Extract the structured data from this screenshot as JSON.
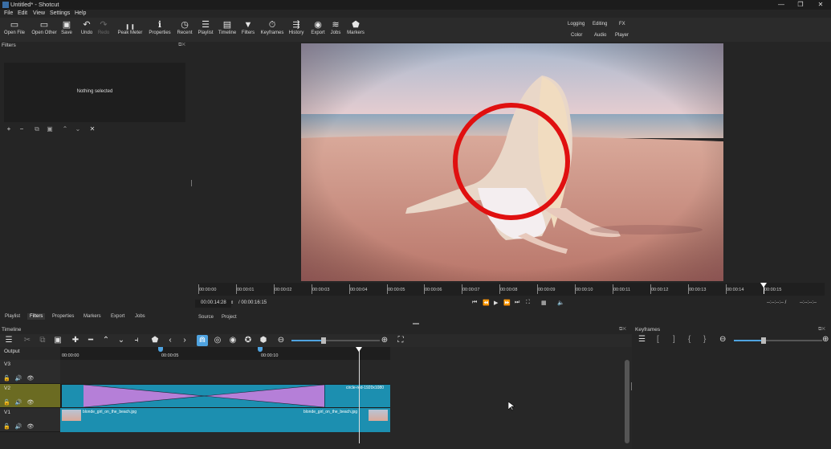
{
  "window": {
    "title": "Untitled* - Shotcut",
    "controls": [
      "—",
      "❐",
      "✕"
    ]
  },
  "menu": [
    "File",
    "Edit",
    "View",
    "Settings",
    "Help"
  ],
  "toolbar": [
    {
      "label": "Open File",
      "icon": "open-file-icon",
      "glyph": "▭",
      "enabled": true
    },
    {
      "label": "Open Other",
      "icon": "open-other-icon",
      "glyph": "▭",
      "enabled": true
    },
    {
      "label": "Save",
      "icon": "save-icon",
      "glyph": "▣",
      "enabled": true
    },
    {
      "label": "Undo",
      "icon": "undo-icon",
      "glyph": "↶",
      "enabled": true
    },
    {
      "label": "Redo",
      "icon": "redo-icon",
      "glyph": "↷",
      "enabled": false
    },
    {
      "label": "Peak Meter",
      "icon": "peak-meter-icon",
      "glyph": "╻╻",
      "enabled": true
    },
    {
      "label": "Properties",
      "icon": "properties-icon",
      "glyph": "ℹ",
      "enabled": true
    },
    {
      "label": "Recent",
      "icon": "recent-icon",
      "glyph": "◷",
      "enabled": true
    },
    {
      "label": "Playlist",
      "icon": "playlist-icon",
      "glyph": "☰",
      "enabled": true
    },
    {
      "label": "Timeline",
      "icon": "timeline-icon",
      "glyph": "▤",
      "enabled": true
    },
    {
      "label": "Filters",
      "icon": "filters-icon",
      "glyph": "▼",
      "enabled": true
    },
    {
      "label": "Keyframes",
      "icon": "keyframes-icon",
      "glyph": "⏱",
      "enabled": true
    },
    {
      "label": "History",
      "icon": "history-icon",
      "glyph": "⇶",
      "enabled": true
    },
    {
      "label": "Export",
      "icon": "export-icon",
      "glyph": "◉",
      "enabled": true
    },
    {
      "label": "Jobs",
      "icon": "jobs-icon",
      "glyph": "≋",
      "enabled": true
    },
    {
      "label": "Markers",
      "icon": "markers-icon",
      "glyph": "⬟",
      "enabled": true
    }
  ],
  "layouts": {
    "row1": [
      "Logging",
      "Editing",
      "FX"
    ],
    "row2": [
      "Color",
      "Audio",
      "Player"
    ]
  },
  "filters_panel": {
    "title": "Filters",
    "empty_text": "Nothing selected"
  },
  "left_tabs": [
    "Playlist",
    "Filters",
    "Properties",
    "Markers",
    "Export",
    "Jobs"
  ],
  "left_tabs_active": 1,
  "viewer": {
    "ruler_ticks": [
      "00:00:00",
      "00:00:01",
      "00:00:02",
      "00:00:03",
      "00:00:04",
      "00:00:05",
      "00:00:06",
      "00:00:07",
      "00:00:08",
      "00:00:09",
      "00:00:10",
      "00:00:11",
      "00:00:12",
      "00:00:13",
      "00:00:14",
      "00:00:15"
    ],
    "position": "00:00:14:28",
    "duration": "/ 00:00:16:15",
    "in_point": "--:--:--:-- /",
    "out_point": "--:--:--:--",
    "tabs": [
      "Source",
      "Project"
    ]
  },
  "timeline": {
    "title": "Timeline",
    "ruler_ticks": [
      "00:00:00",
      "00:00:05",
      "00:00:10"
    ],
    "tracks": [
      {
        "name": "Output"
      },
      {
        "name": "V3"
      },
      {
        "name": "V2"
      },
      {
        "name": "V1"
      }
    ],
    "clips": {
      "v2_clip": "circle-red-1920x1080",
      "v1_clip_start": "blonde_girl_on_the_beach.jpg",
      "v1_clip_end": "blonde_girl_on_the_beach.jpg"
    }
  },
  "keyframes_panel": {
    "title": "Keyframes"
  },
  "colors": {
    "accent": "#4fa3e0",
    "v2_track_head": "#6b6b22",
    "clip_teal": "#1c8fb0",
    "transition_purple": "#b57fd8",
    "circle_red": "#e01010"
  }
}
